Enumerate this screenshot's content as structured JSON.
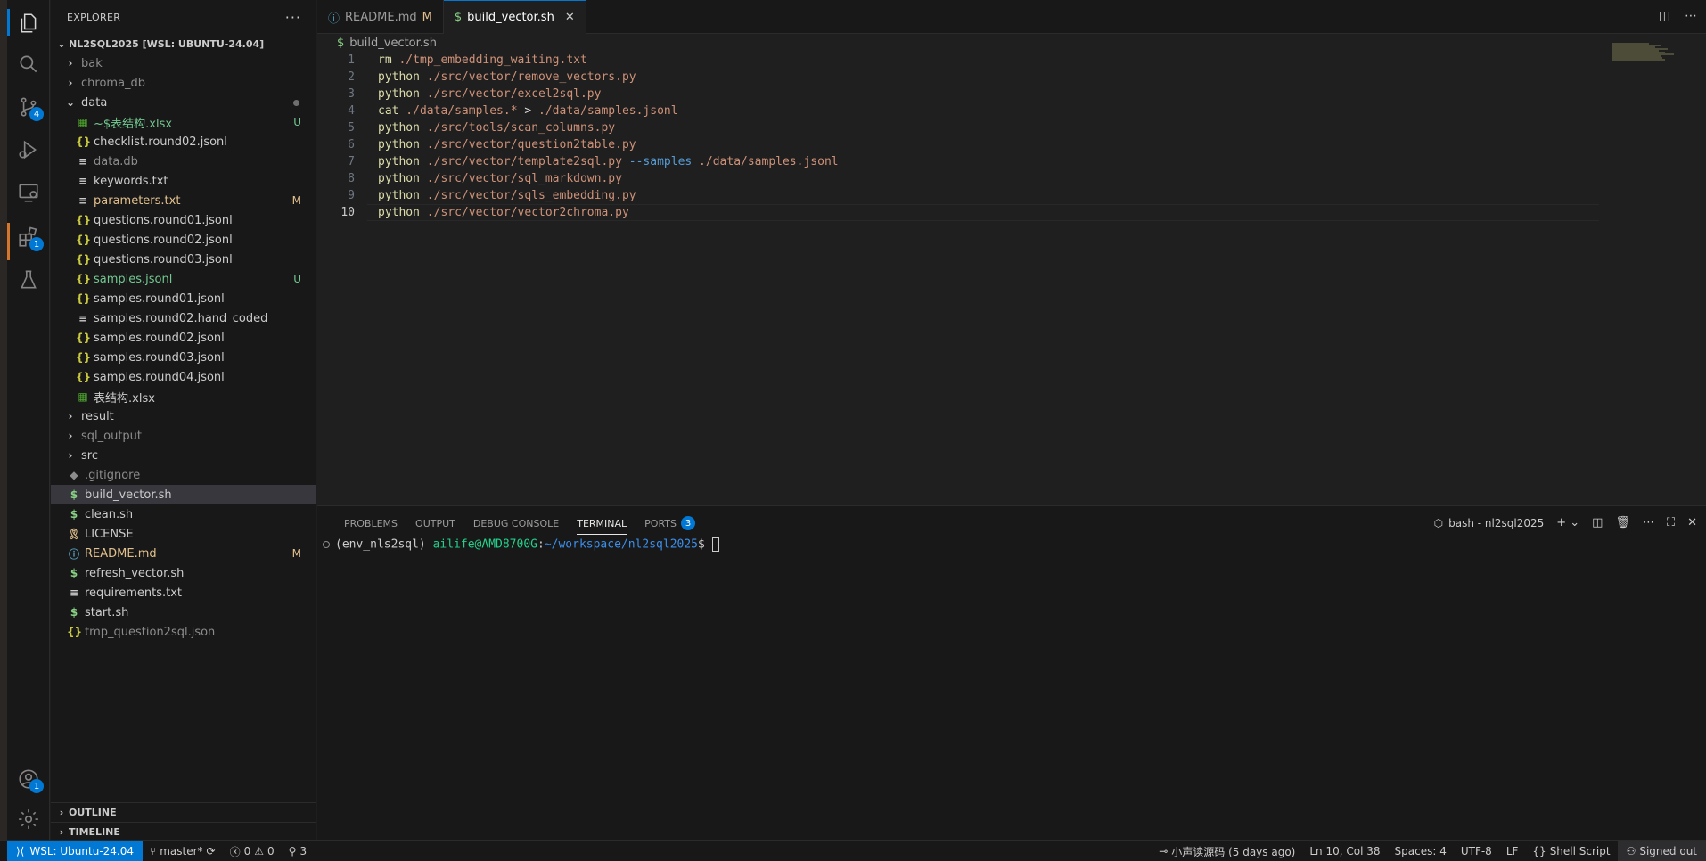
{
  "activity_bar": {
    "source_control_badge": "4",
    "extensions_badge": "1",
    "accounts_badge": "1"
  },
  "sidebar": {
    "title": "EXPLORER",
    "more": "···",
    "root": "NL2SQL2025 [WSL: UBUNTU-24.04]",
    "items": [
      {
        "label": "bak",
        "kind": "folder",
        "status": ""
      },
      {
        "label": "chroma_db",
        "kind": "folder",
        "status": ""
      },
      {
        "label": "data",
        "kind": "folder-open",
        "status": ""
      },
      {
        "label": "~$表结构.xlsx",
        "kind": "xls",
        "status": "U"
      },
      {
        "label": "checklist.round02.jsonl",
        "kind": "json",
        "status": ""
      },
      {
        "label": "data.db",
        "kind": "txt",
        "status": ""
      },
      {
        "label": "keywords.txt",
        "kind": "txt",
        "status": ""
      },
      {
        "label": "parameters.txt",
        "kind": "txt",
        "status": "M"
      },
      {
        "label": "questions.round01.jsonl",
        "kind": "json",
        "status": ""
      },
      {
        "label": "questions.round02.jsonl",
        "kind": "json",
        "status": ""
      },
      {
        "label": "questions.round03.jsonl",
        "kind": "json",
        "status": ""
      },
      {
        "label": "samples.jsonl",
        "kind": "json",
        "status": "U"
      },
      {
        "label": "samples.round01.jsonl",
        "kind": "json",
        "status": ""
      },
      {
        "label": "samples.round02.hand_coded",
        "kind": "txt",
        "status": ""
      },
      {
        "label": "samples.round02.jsonl",
        "kind": "json",
        "status": ""
      },
      {
        "label": "samples.round03.jsonl",
        "kind": "json",
        "status": ""
      },
      {
        "label": "samples.round04.jsonl",
        "kind": "json",
        "status": ""
      },
      {
        "label": "表结构.xlsx",
        "kind": "xls",
        "status": ""
      },
      {
        "label": "result",
        "kind": "folder",
        "status": ""
      },
      {
        "label": "sql_output",
        "kind": "folder",
        "status": ""
      },
      {
        "label": "src",
        "kind": "folder",
        "status": ""
      },
      {
        "label": ".gitignore",
        "kind": "git",
        "status": ""
      },
      {
        "label": "build_vector.sh",
        "kind": "sh",
        "status": ""
      },
      {
        "label": "clean.sh",
        "kind": "sh",
        "status": ""
      },
      {
        "label": "LICENSE",
        "kind": "license",
        "status": ""
      },
      {
        "label": "README.md",
        "kind": "info",
        "status": "M"
      },
      {
        "label": "refresh_vector.sh",
        "kind": "sh",
        "status": ""
      },
      {
        "label": "requirements.txt",
        "kind": "txt",
        "status": ""
      },
      {
        "label": "start.sh",
        "kind": "sh",
        "status": ""
      },
      {
        "label": "tmp_question2sql.json",
        "kind": "json",
        "status": ""
      }
    ],
    "outline": "OUTLINE",
    "timeline": "TIMELINE"
  },
  "tabs": [
    {
      "label": "README.md",
      "mark": "M",
      "active": false
    },
    {
      "label": "build_vector.sh",
      "mark": "",
      "active": true
    }
  ],
  "editor": {
    "breadcrumb": "build_vector.sh",
    "current_line": 10,
    "lines": [
      {
        "n": "1",
        "cmd": "rm",
        "arg": " ./tmp_embedding_waiting.txt",
        "flag": "",
        "rest": ""
      },
      {
        "n": "2",
        "cmd": "python",
        "arg": " ./src/vector/remove_vectors.py",
        "flag": "",
        "rest": ""
      },
      {
        "n": "3",
        "cmd": "python",
        "arg": " ./src/vector/excel2sql.py",
        "flag": "",
        "rest": ""
      },
      {
        "n": "4",
        "cmd": "cat",
        "arg": " ./data/samples.*",
        "flag": " > ",
        "rest": "./data/samples.jsonl"
      },
      {
        "n": "5",
        "cmd": "python",
        "arg": " ./src/tools/scan_columns.py",
        "flag": "",
        "rest": ""
      },
      {
        "n": "6",
        "cmd": "python",
        "arg": " ./src/vector/question2table.py",
        "flag": "",
        "rest": ""
      },
      {
        "n": "7",
        "cmd": "python",
        "arg": " ./src/vector/template2sql.py ",
        "flag": "--samples",
        "rest": " ./data/samples.jsonl"
      },
      {
        "n": "8",
        "cmd": "python",
        "arg": " ./src/vector/sql_markdown.py",
        "flag": "",
        "rest": ""
      },
      {
        "n": "9",
        "cmd": "python",
        "arg": " ./src/vector/sqls_embedding.py",
        "flag": "",
        "rest": ""
      },
      {
        "n": "10",
        "cmd": "python",
        "arg": " ./src/vector/vector2chroma.py",
        "flag": "",
        "rest": ""
      }
    ]
  },
  "panel": {
    "tabs": [
      {
        "label": "PROBLEMS",
        "badge": ""
      },
      {
        "label": "OUTPUT",
        "badge": ""
      },
      {
        "label": "DEBUG CONSOLE",
        "badge": ""
      },
      {
        "label": "TERMINAL",
        "badge": ""
      },
      {
        "label": "PORTS",
        "badge": "3"
      }
    ],
    "terminal_name": "bash - nl2sql2025",
    "prompt_env": "(env_nls2sql) ",
    "prompt_user": "ailife@AMD8700G",
    "prompt_sep": ":",
    "prompt_path": "~/workspace/nl2sql2025",
    "prompt_end": "$ "
  },
  "statusbar": {
    "remote": "WSL: Ubuntu-24.04",
    "branch": "master*",
    "errors": "0",
    "warnings": "0",
    "ports": "3",
    "blame": "小声读源码 (5 days ago)",
    "cursor": "Ln 10, Col 38",
    "spaces": "Spaces: 4",
    "encoding": "UTF-8",
    "eol": "LF",
    "language": "Shell Script",
    "account": "Signed out"
  }
}
